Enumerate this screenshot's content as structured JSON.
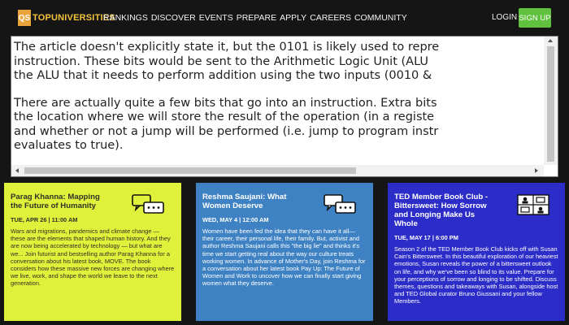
{
  "header": {
    "logo_badge": "QS",
    "logo_text": "TOPUNIVERSITIES",
    "nav": [
      "RANKINGS",
      "DISCOVER",
      "EVENTS",
      "PREPARE",
      "APPLY",
      "CAREERS",
      "COMMUNITY"
    ],
    "login": "LOGIN",
    "signup": "SIGN UP"
  },
  "article": {
    "p1": [
      "The article doesn't explicitly state it, but the 0101 is likely used to repre",
      "instruction. These bits would be sent to the Arithmetic Logic Unit (ALU",
      "the ALU that it needs to perform addition using the two inputs (0010 &"
    ],
    "p2": [
      "There are actually quite a few bits that go into an instruction. Extra bits",
      "the location where we will store the result of the operation (in a registe",
      "and whether or not a jump will be performed (i.e. jump to program instr",
      "evaluates to true)."
    ]
  },
  "cards": [
    {
      "title": "Parag Khanna: Mapping the Future of Humanity",
      "date": "TUE, APR 26 | 11:00 AM",
      "body": "Wars and migrations, pandemics and climate change — these are the elements that shaped human history. And they are now being accelerated by technology — but what are we... Join futurist and bestselling author Parag Khanna for a conversation about his latest book, MOVE. The book considers how these massive new forces are changing where we live, work, and shape the world we leave to the next generation.",
      "color": "#dff13a"
    },
    {
      "title": "Reshma Saujani: What Women Deserve",
      "date": "WED, MAY 4 | 12:00 AM",
      "body": "Women have been fed the idea that they can have it all— their career, their personal life, their family. But, activist and author Reshma Saujani calls this \"the big lie\" and thinks it's time we start getting real about the way our culture treats working women. In advance of Mother's Day, join Reshma for a conversation about her latest book Pay Up: The Future of Women and Work to uncover how we can finally start giving women what they deserve.",
      "color": "#3f82c3"
    },
    {
      "title": "TED Member Book Club - Bittersweet: How Sorrow and Longing Make Us Whole",
      "date": "TUE, MAY 17 | 6:00 PM",
      "body": "Season 2 of the TED Member Book Club kicks off with Susan Cain's Bittersweet. In this beautiful exploration of our heaviest emotions, Susan reveals the power of a bittersweet outlook on life, and why we've been so blind to its value. Prepare for your perceptions of sorrow and longing to be shifted. Discuss themes, questions and takeaways with Susan, alongside host and TED Global curator Bruno Giussani and your fellow Members.",
      "color": "#2c2cc9"
    }
  ],
  "icons": {
    "card_1": "speech-bubbles-icon",
    "card_2": "speech-bubbles-icon",
    "card_3": "book-club-icon"
  }
}
